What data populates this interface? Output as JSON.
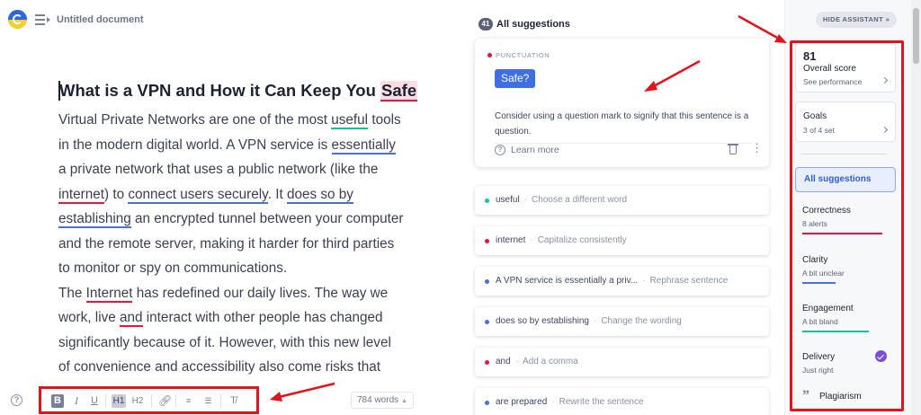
{
  "header": {
    "doc_title": "Untitled document"
  },
  "editor": {
    "heading": {
      "before": "What is a VPN and How it Can Keep You ",
      "flagged": "Safe"
    },
    "paragraph1": [
      [
        "Virtual Private Networks are one of the most ",
        {
          "t": "useful",
          "u": "green"
        },
        " tools"
      ],
      [
        "in the modern digital world. A VPN service is ",
        {
          "t": "essentially",
          "u": "blue"
        }
      ],
      [
        "a private network that uses a public network (like the"
      ],
      [
        {
          "t": "internet",
          "u": "red"
        },
        ") to ",
        {
          "t": "connect users securely",
          "u": "blue"
        },
        ". It ",
        {
          "t": "does so by",
          "u": "blue"
        }
      ],
      [
        {
          "t": "establishing",
          "u": "blue"
        },
        " an encrypted tunnel between your computer"
      ],
      [
        "and the remote server, making it harder for third parties"
      ],
      [
        "to monitor or spy on communications."
      ]
    ],
    "paragraph2": [
      [
        "The ",
        {
          "t": "Internet",
          "u": "red"
        },
        " has redefined our daily lives. The way we"
      ],
      [
        "work, live ",
        {
          "t": "and",
          "u": "red"
        },
        " interact with other people has changed"
      ],
      [
        "significantly because of it. However, with this new level"
      ],
      [
        "of convenience and accessibility also come risks that"
      ]
    ]
  },
  "toolbar": {
    "bold": "B",
    "italic": "I",
    "underline": "U",
    "h1": "H1",
    "h2": "H2",
    "link_icon": "link-icon",
    "ordered_list_icon": "ordered-list-icon",
    "bullet_list_icon": "bullet-list-icon",
    "clear_format_icon": "clear-format-icon",
    "word_count": "784 words"
  },
  "suggestions": {
    "count": "41",
    "title": "All suggestions",
    "active_card": {
      "category": "PUNCTUATION",
      "replacement": "Safe?",
      "description": "Consider using a question mark to signify that this sentence is a question.",
      "learn_more": "Learn more"
    },
    "items": [
      {
        "word": "useful",
        "hint": "Choose a different word",
        "color": "#15c39a"
      },
      {
        "word": "internet",
        "hint": "Capitalize consistently",
        "color": "#e5173f"
      },
      {
        "word": "A VPN service is essentially a priv...",
        "hint": "Rephrase sentence",
        "color": "#4a6ee0"
      },
      {
        "word": "does so by establishing",
        "hint": "Change the wording",
        "color": "#4a6ee0"
      },
      {
        "word": "and",
        "hint": "Add a comma",
        "color": "#e5173f"
      },
      {
        "word": "are prepared",
        "hint": "Rewrite the sentence",
        "color": "#4a6ee0"
      }
    ]
  },
  "assistant": {
    "hide_label": "HIDE ASSISTANT",
    "score": "81",
    "score_label": "Overall score",
    "score_sub": "See performance",
    "goals_label": "Goals",
    "goals_sub": "3 of 4 set",
    "all_suggestions": "All suggestions",
    "categories": [
      {
        "name": "Correctness",
        "state": "8 alerts",
        "color": "#e5173f",
        "level": 0.97
      },
      {
        "name": "Clarity",
        "state": "A bit unclear",
        "color": "#4a6ee0",
        "level": 0.4
      },
      {
        "name": "Engagement",
        "state": "A bit bland",
        "color": "#15c39a",
        "level": 0.8
      },
      {
        "name": "Delivery",
        "state": "Just right",
        "color": "#7b4cd9",
        "level": 1.0
      }
    ],
    "plagiarism": "Plagiarism"
  },
  "colors": {
    "accent": "#3f6ee6",
    "alert_red": "#e5173f",
    "annotation_red": "#e0141d",
    "good_green": "#15c39a",
    "delivery_purple": "#7b4cd9"
  }
}
